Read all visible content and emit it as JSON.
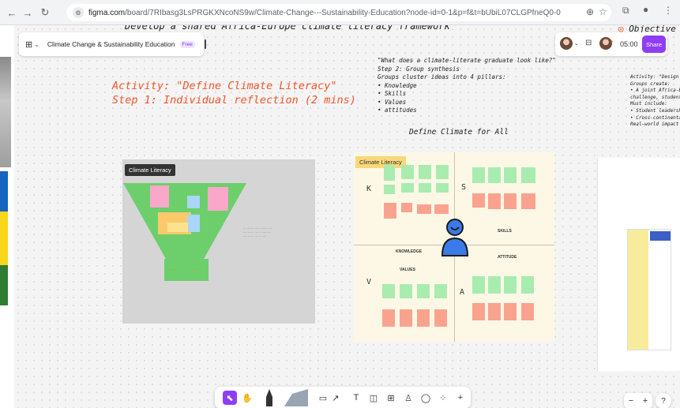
{
  "browser": {
    "url_host": "figma.com",
    "url_rest": "/board/7RIbasg3LsPRGKXNcoNS9w/Climate-Change---Sustainability-Education?node-id=0-1&p=f&t=bUbiL07CLGPfneQ0-0"
  },
  "file": {
    "name": "Climate Change & Sustainability Education",
    "plan_badge": "Free"
  },
  "header": {
    "timer": "05:00",
    "share_label": "Share"
  },
  "canvas": {
    "top_heading": "Develop a shared Africa-Europe climate literacy framework",
    "objective_label": "Objective",
    "activity_line1": "Activity: \"Define Climate Literacy\"",
    "activity_line2": "Step 1: Individual reflection (2 mins)",
    "synthesis_lines": [
      "\"What does a climate-literate graduate look like?\"",
      "Step 2: Group synthesis",
      "Groups cluster ideas into 4 pillars:",
      "• Knowledge",
      "• Skills",
      "• Values",
      "• attitudes"
    ],
    "define_all": "Define Climate for All",
    "right_notes": [
      "Activity: \"Design a Yo",
      "Groups create:",
      "• A joint Africa-Euro",
      "  challenge, student",
      "Must include:",
      "• Student leadership",
      "• Cross-continental co",
      "Real-world impact"
    ]
  },
  "frames": {
    "left_title": "Climate Literacy",
    "center_title": "Climate Literacy",
    "center_letters": {
      "k": "K",
      "s": "S",
      "v": "V",
      "a": "A"
    },
    "center_labels": {
      "skills": "SKILLS",
      "knowledge": "KNOWLEDGE",
      "attitude": "ATTITUDE",
      "values": "VALUES"
    }
  },
  "colors": {
    "accent": "#8f3df5",
    "activity_text": "#f2552c",
    "funnel_green": "#6ccf6c",
    "sticky_green": "#a9ecb0",
    "sticky_pink": "#f9a38f",
    "sticky_yellow": "#fbe38e",
    "avatar_blue": "#3b7be8"
  },
  "toolbar": {
    "tools": [
      "select-tool",
      "hand-tool",
      "marker-tool",
      "highlighter-tool",
      "shape-tool",
      "text-tool",
      "sticky-note-tool",
      "table-tool",
      "stamp-tool",
      "comment-tool",
      "more-tools",
      "add-tool"
    ]
  },
  "zoom": {
    "minus": "−",
    "plus": "+",
    "help": "?"
  }
}
